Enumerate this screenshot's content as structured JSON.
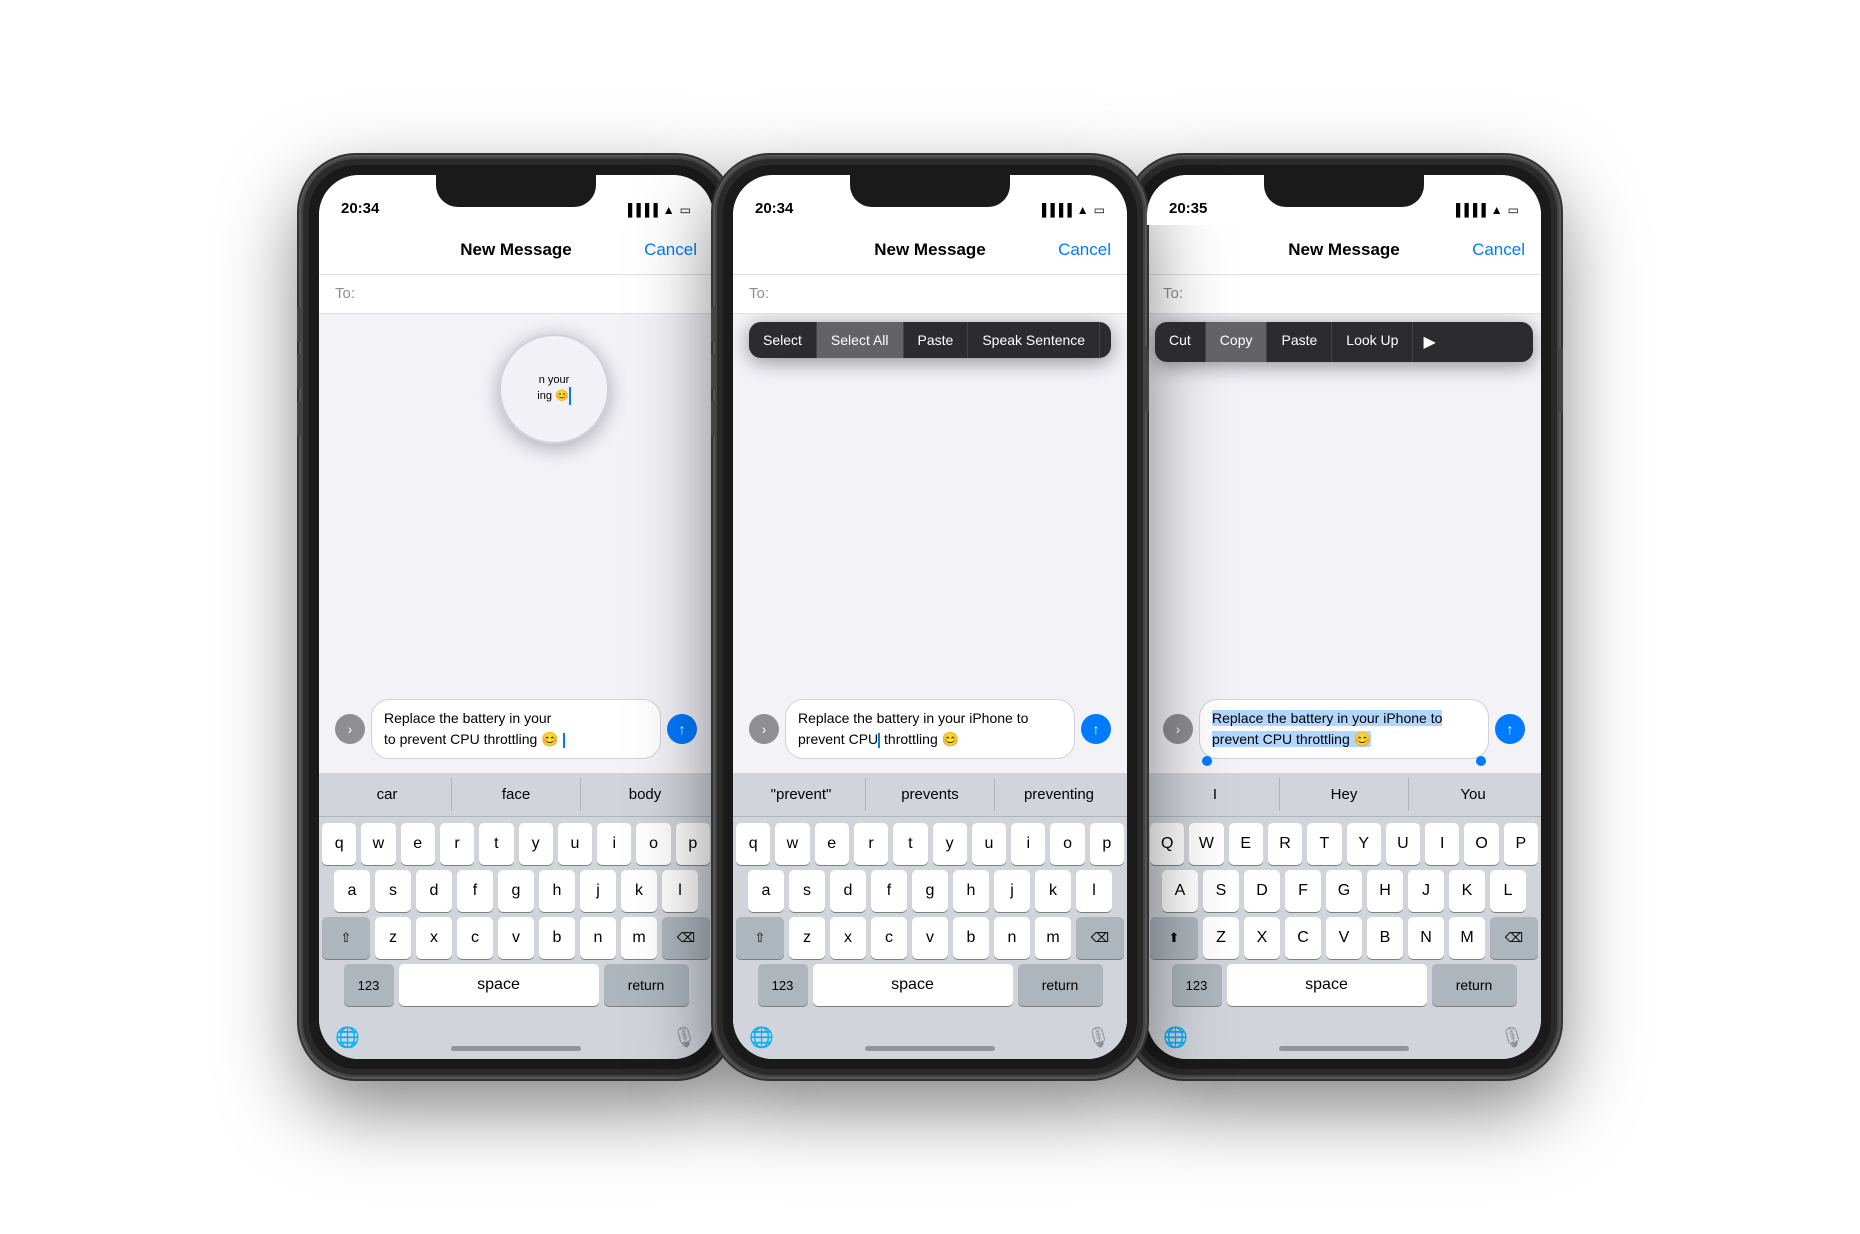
{
  "phones": [
    {
      "id": "phone1",
      "time": "20:34",
      "nav": {
        "title": "New Message",
        "cancel": "Cancel"
      },
      "to_label": "To:",
      "message_text": "Replace the battery in your\nto prevent CPU throttling 😊",
      "suggestions": [
        "car",
        "face",
        "body"
      ],
      "keyboard_mode": "lowercase",
      "show_loupe": true,
      "loupe_text": "n your\ning 😊",
      "compose_arrow": "›",
      "send_icon": "↑"
    },
    {
      "id": "phone2",
      "time": "20:34",
      "nav": {
        "title": "New Message",
        "cancel": "Cancel"
      },
      "to_label": "To:",
      "message_text": "Replace the battery in your iPhone to prevent CPU throttling 😊",
      "suggestions": [
        "\"prevent\"",
        "prevents",
        "preventing"
      ],
      "keyboard_mode": "lowercase",
      "show_context_menu": true,
      "context_menu_items": [
        "Select",
        "Select All",
        "Paste",
        "Speak Sentence"
      ],
      "compose_arrow": "›",
      "send_icon": "↑"
    },
    {
      "id": "phone3",
      "time": "20:35",
      "nav": {
        "title": "New Message",
        "cancel": "Cancel"
      },
      "to_label": "To:",
      "message_text": "Replace the battery in your iPhone to prevent CPU throttling 😊",
      "suggestions": [
        "I",
        "Hey",
        "You"
      ],
      "keyboard_mode": "uppercase",
      "show_context_menu": true,
      "context_menu_items": [
        "Cut",
        "Copy",
        "Paste",
        "Look Up"
      ],
      "active_menu_item": "Copy",
      "show_selection": true,
      "compose_arrow": "›",
      "send_icon": "↑"
    }
  ],
  "keyboard": {
    "rows_lower": [
      [
        "q",
        "w",
        "e",
        "r",
        "t",
        "y",
        "u",
        "i",
        "o",
        "p"
      ],
      [
        "a",
        "s",
        "d",
        "f",
        "g",
        "h",
        "j",
        "k",
        "l"
      ],
      [
        "z",
        "x",
        "c",
        "v",
        "b",
        "n",
        "m"
      ]
    ],
    "rows_upper": [
      [
        "Q",
        "W",
        "E",
        "R",
        "T",
        "Y",
        "U",
        "I",
        "O",
        "P"
      ],
      [
        "A",
        "S",
        "D",
        "F",
        "G",
        "H",
        "J",
        "K",
        "L"
      ],
      [
        "Z",
        "X",
        "C",
        "V",
        "B",
        "N",
        "M"
      ]
    ],
    "special": {
      "shift": "⇧",
      "delete": "⌫",
      "num": "123",
      "space": "space",
      "return": "return",
      "globe": "🌐",
      "mic": "🎤"
    }
  }
}
